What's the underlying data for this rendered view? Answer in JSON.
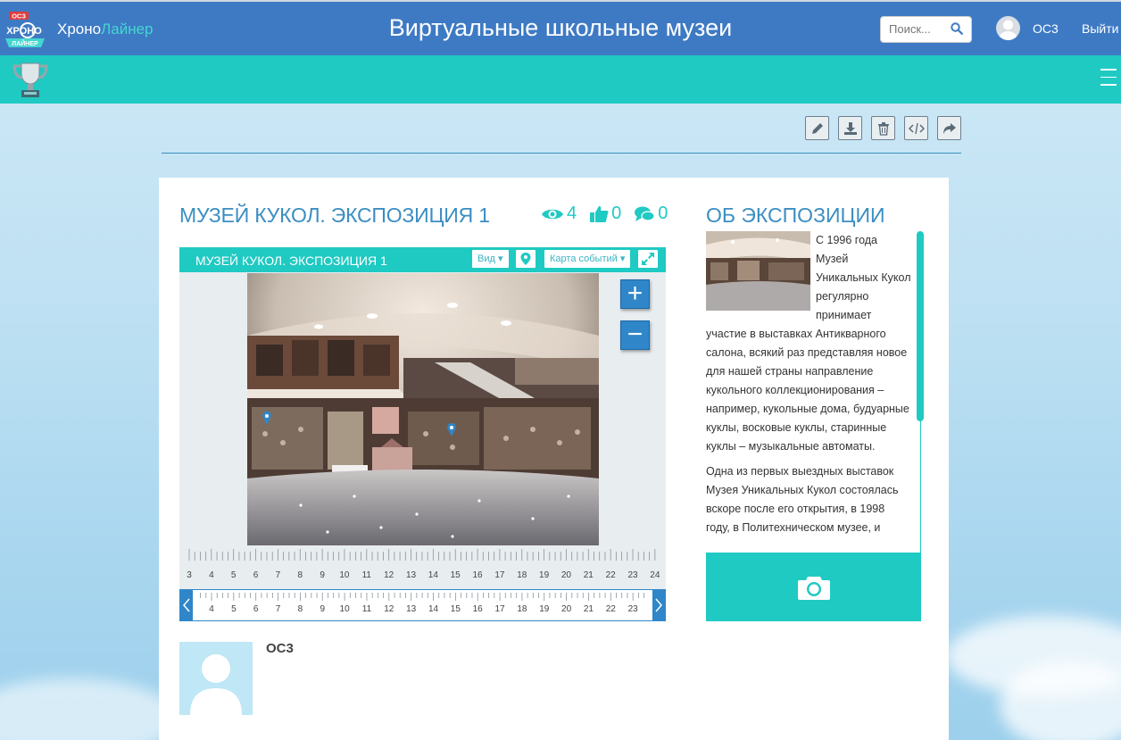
{
  "header": {
    "logo_text_top": "ОСЗ",
    "logo_text_mid": "ХРОНО",
    "logo_text_bottom": "ЛАЙНЕР",
    "brand_part1": "Хроно",
    "brand_part2": "Лайнер",
    "site_title": "Виртуальные школьные музеи",
    "search_placeholder": "Поиск...",
    "user_name": "ОС3",
    "logout_label": "Выйти"
  },
  "toolbar": {
    "buttons": [
      "edit-icon",
      "download-icon",
      "trash-icon",
      "code-icon",
      "share-icon"
    ]
  },
  "exposition": {
    "title": "МУЗЕЙ КУКОЛ. ЭКСПОЗИЦИЯ 1",
    "views": "4",
    "likes": "0",
    "comments": "0"
  },
  "viewer": {
    "title": "МУЗЕЙ КУКОЛ. ЭКСПОЗИЦИЯ 1",
    "view_button": "Вид",
    "events_map_button": "Карта событий",
    "zoom_in": "+",
    "zoom_out": "−",
    "ruler_labels": [
      "3",
      "4",
      "5",
      "6",
      "7",
      "8",
      "9",
      "10",
      "11",
      "12",
      "13",
      "14",
      "15",
      "16",
      "17",
      "18",
      "19",
      "20",
      "21",
      "22",
      "23",
      "24"
    ],
    "timebar_labels": [
      "4",
      "5",
      "6",
      "7",
      "8",
      "9",
      "10",
      "11",
      "12",
      "13",
      "14",
      "15",
      "16",
      "17",
      "18",
      "19",
      "20",
      "21",
      "22",
      "23"
    ]
  },
  "about": {
    "title": "ОБ ЭКСПОЗИЦИИ",
    "paragraph1": "С 1996 года Музей Уникальных Кукол регулярно принимает участие в выставках Антикварного салона, всякий раз представляя новое для нашей страны направление кукольного коллекционирования – например, кукольные дома, будуарные куклы, восковые куклы, старинные куклы – музыкальные автоматы.",
    "paragraph2": "Одна из первых выездных выставок Музея Уникальных Кукол состоялась вскоре после его открытия, в 1998 году, в Политехническом музее, и"
  },
  "author": {
    "name": "ОС3"
  },
  "colors": {
    "header_blue": "#3e7ac4",
    "teal": "#1fcac3",
    "title_blue": "#3b8ec2",
    "zoom_blue": "#2f86c8"
  }
}
